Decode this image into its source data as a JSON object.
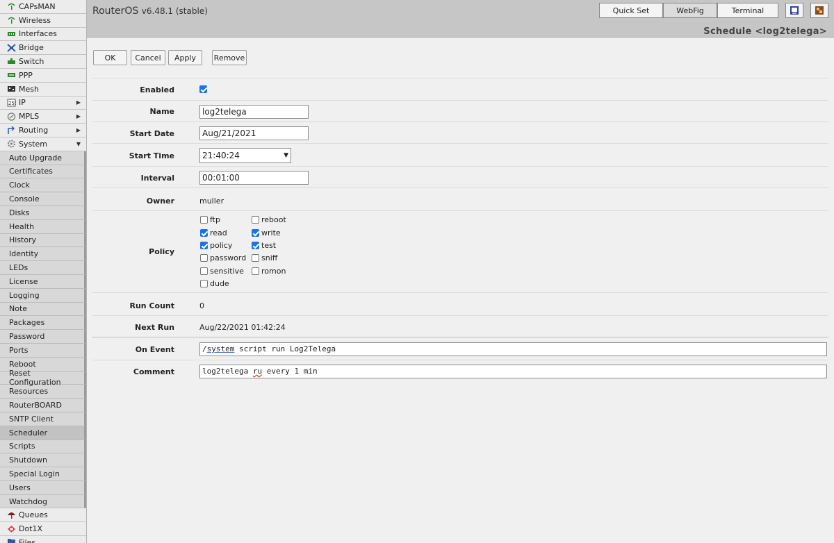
{
  "app": {
    "brand": "RouterOS",
    "version": "v6.48.1 (stable)",
    "page_title": "Schedule <log2telega>"
  },
  "top_nav": {
    "quick_set": "Quick Set",
    "webfig": "WebFig",
    "terminal": "Terminal"
  },
  "sidebar": {
    "menu_top": [
      {
        "label": "CAPsMAN",
        "icon": "capsman-icon"
      },
      {
        "label": "Wireless",
        "icon": "wireless-icon"
      },
      {
        "label": "Interfaces",
        "icon": "interfaces-icon"
      },
      {
        "label": "Bridge",
        "icon": "bridge-icon"
      },
      {
        "label": "Switch",
        "icon": "switch-icon"
      },
      {
        "label": "PPP",
        "icon": "ppp-icon"
      },
      {
        "label": "Mesh",
        "icon": "mesh-icon"
      },
      {
        "label": "IP",
        "icon": "ip-icon"
      },
      {
        "label": "MPLS",
        "icon": "mpls-icon"
      },
      {
        "label": "Routing",
        "icon": "routing-icon"
      },
      {
        "label": "System",
        "icon": "system-icon"
      }
    ],
    "system_sub": [
      "Auto Upgrade",
      "Certificates",
      "Clock",
      "Console",
      "Disks",
      "Health",
      "History",
      "Identity",
      "LEDs",
      "License",
      "Logging",
      "Note",
      "Packages",
      "Password",
      "Ports",
      "Reboot",
      "Reset Configuration",
      "Resources",
      "RouterBOARD",
      "SNTP Client",
      "Scheduler",
      "Scripts",
      "Shutdown",
      "Special Login",
      "Users",
      "Watchdog"
    ],
    "menu_bottom": [
      {
        "label": "Queues",
        "icon": "queues-icon"
      },
      {
        "label": "Dot1X",
        "icon": "dot1x-icon"
      },
      {
        "label": "Files",
        "icon": "files-icon"
      }
    ]
  },
  "actions": {
    "ok": "OK",
    "cancel": "Cancel",
    "apply": "Apply",
    "remove": "Remove"
  },
  "form": {
    "enabled_label": "Enabled",
    "name_label": "Name",
    "name_value": "log2telega",
    "start_date_label": "Start Date",
    "start_date_value": "Aug/21/2021",
    "start_time_label": "Start Time",
    "start_time_value": "21:40:24",
    "interval_label": "Interval",
    "interval_value": "00:01:00",
    "owner_label": "Owner",
    "owner_value": "muller",
    "policy_label": "Policy",
    "policies": {
      "ftp": "ftp",
      "reboot": "reboot",
      "read": "read",
      "write": "write",
      "policy": "policy",
      "test": "test",
      "password": "password",
      "sniff": "sniff",
      "sensitive": "sensitive",
      "romon": "romon",
      "dude": "dude"
    },
    "run_count_label": "Run Count",
    "run_count_value": "0",
    "next_run_label": "Next Run",
    "next_run_value": "Aug/22/2021 01:42:24",
    "on_event_label": "On Event",
    "on_event_part1": "/",
    "on_event_part2": "system",
    "on_event_part3": " script run Log2Telega",
    "comment_label": "Comment",
    "comment_part1": "log2telega ",
    "comment_part2": "ru",
    "comment_part3": " every 1 min"
  }
}
